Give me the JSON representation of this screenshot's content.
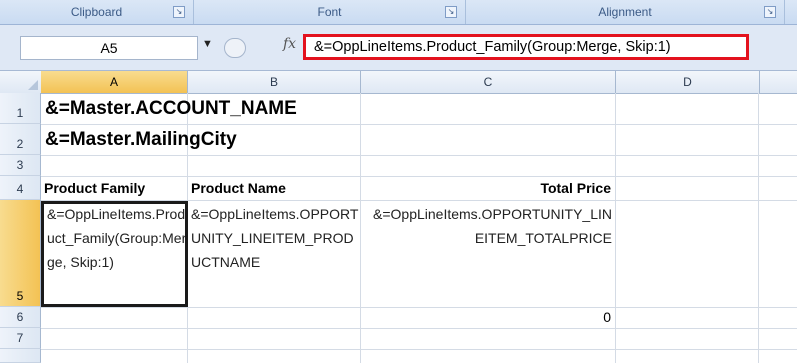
{
  "ribbon": {
    "groups": [
      "Clipboard",
      "Font",
      "Alignment"
    ]
  },
  "formula_bar": {
    "name_box": "A5",
    "fx_label": "fx",
    "formula": "&=OppLineItems.Product_Family(Group:Merge, Skip:1)"
  },
  "columns": [
    "A",
    "B",
    "C",
    "D"
  ],
  "rows": [
    "1",
    "2",
    "3",
    "4",
    "5",
    "6",
    "7"
  ],
  "cells": {
    "a1": "&=Master.ACCOUNT_NAME",
    "a2": "&=Master.MailingCity",
    "a4": "Product Family",
    "b4": "Product Name",
    "c4": "Total Price",
    "a5": "&=OppLineItems.Product_Family(Group:Merge, Skip:1)",
    "b5": "&=OppLineItems.OPPORTUNITY_LINEITEM_PRODUCTNAME",
    "c5": "&=OppLineItems.OPPORTUNITY_LINEITEM_TOTALPRICE",
    "c6": "0"
  },
  "colors": {
    "formula_highlight": "#e3121e",
    "selected_header": "#f3c254"
  }
}
